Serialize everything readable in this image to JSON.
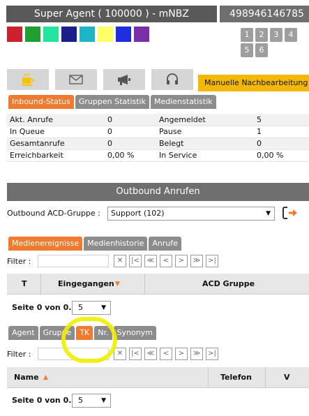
{
  "header": {
    "agent_title": "Super Agent ( 100000 ) - mNBZ",
    "agent_id": "498946146785"
  },
  "status_colors": [
    "#cc1f2f",
    "#20a033",
    "#22e5a0",
    "#1a1f8a",
    "#1fb4c8",
    "#ffff66",
    "#1f2fe0",
    "#7b2fa8"
  ],
  "number_buttons": [
    "1",
    "2",
    "3",
    "4",
    "5",
    "6"
  ],
  "icons": [
    "coffee-icon",
    "mail-icon",
    "megaphone-icon",
    "headset-icon"
  ],
  "manual_label": "Manuelle Nachbearbeitung",
  "stat_tabs": [
    "Inbound-Status",
    "Gruppen Statistik",
    "Medienstatistik"
  ],
  "stats": [
    {
      "l1": "Akt. Anrufe",
      "v1": "0",
      "l2": "Angemeldet",
      "v2": "5"
    },
    {
      "l1": "In Queue",
      "v1": "0",
      "l2": "Pause",
      "v2": "1"
    },
    {
      "l1": "Gesamtanrufe",
      "v1": "0",
      "l2": "Belegt",
      "v2": "0"
    },
    {
      "l1": "Erreichbarkeit",
      "v1": "0,00 %",
      "l2": "In Service",
      "v2": "0,00 %"
    }
  ],
  "outbound": {
    "header": "Outbound Anrufen",
    "label": "Outbound ACD-Gruppe :",
    "selected": "Support (102)"
  },
  "media_tabs": [
    "Medienereignisse",
    "Medienhistorie",
    "Anrufe"
  ],
  "filter_label": "Filter :",
  "pager_icons": [
    "clear-filter-icon",
    "first-page-icon",
    "fast-back-icon",
    "prev-page-icon",
    "next-page-icon",
    "fast-forward-icon",
    "last-page-icon"
  ],
  "pager_glyphs": [
    "✕",
    "|<",
    "≪",
    "<",
    ">",
    "≫",
    ">|"
  ],
  "media_table": {
    "col_t": "T",
    "col_received": "Eingegangen",
    "col_group": "ACD Gruppe"
  },
  "page_info": "Seite 0 von 0.",
  "page_size": "5",
  "contact_tabs": [
    "Agent",
    "Gruppe",
    "TK",
    "Nr.",
    "Synonym"
  ],
  "contact_table": {
    "col_name": "Name",
    "col_phone": "Telefon",
    "col_v": "V"
  }
}
